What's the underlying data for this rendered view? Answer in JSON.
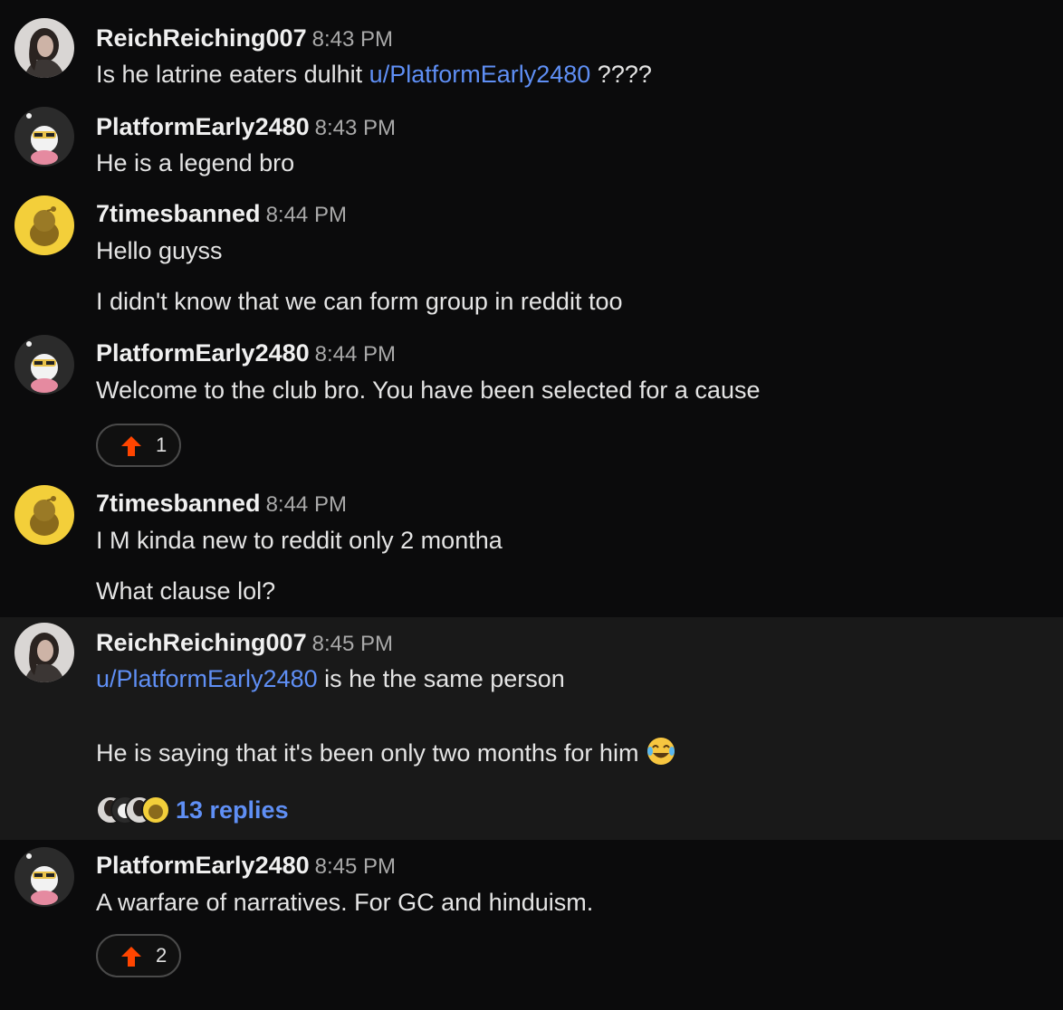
{
  "messages": [
    {
      "user": "ReichReiching007",
      "time": "8:43 PM",
      "line1_text": "Is he latrine eaters dulhit ",
      "line1_mention": "u/PlatformEarly2480",
      "line1_after": " ????"
    },
    {
      "user": "PlatformEarly2480",
      "time": "8:43 PM",
      "line1": "He is a legend bro"
    },
    {
      "user": "7timesbanned",
      "time": "8:44 PM",
      "line1": "Hello guyss",
      "line2": "I didn't know that we can form group in reddit too"
    },
    {
      "user": "PlatformEarly2480",
      "time": "8:44 PM",
      "line1": "Welcome to the club bro. You have been selected for a cause",
      "upvotes": "1"
    },
    {
      "user": "7timesbanned",
      "time": "8:44 PM",
      "line1": "I M kinda new to reddit only 2 montha",
      "line2": "What clause lol?"
    },
    {
      "user": "ReichReiching007",
      "time": "8:45 PM",
      "line1_mention": "u/PlatformEarly2480",
      "line1_after": " is he the same person",
      "line2": "He is saying that it's been only two months for him",
      "line2_emoji": "joy-emoji",
      "replies": "13 replies"
    },
    {
      "user": "PlatformEarly2480",
      "time": "8:45 PM",
      "line1": "A warfare of narratives. For GC and hinduism.",
      "upvotes": "2"
    }
  ],
  "colors": {
    "background": "#0b0b0c",
    "highlight_row": "#191919",
    "mention": "#5f8ff5",
    "upvote": "#ff4500",
    "username": "#f0f0f0",
    "timestamp": "#a9a9a9"
  },
  "icons": [
    "upvote-arrow-icon",
    "avatar-image",
    "snoo-avatar",
    "joy-emoji"
  ]
}
